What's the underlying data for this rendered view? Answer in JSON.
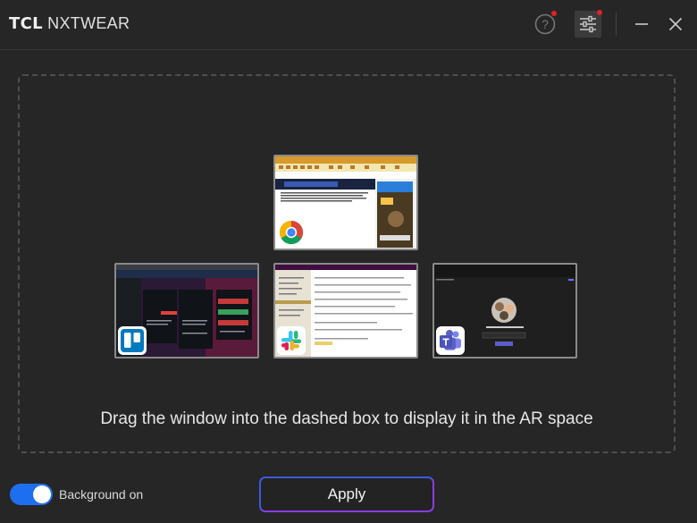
{
  "header": {
    "brand_bold": "TCL",
    "brand_light": "NXTWEAR"
  },
  "toolbar": {
    "help_icon": "help-circle-icon",
    "settings_icon": "sliders-icon",
    "minimize_icon": "minimize-icon",
    "close_icon": "close-icon",
    "notification_dot_color": "#e0202a"
  },
  "windows": [
    {
      "app": "chrome",
      "icon": "chrome-icon"
    },
    {
      "app": "trello",
      "icon": "trello-icon"
    },
    {
      "app": "slack",
      "icon": "slack-icon"
    },
    {
      "app": "teams",
      "icon": "teams-icon"
    }
  ],
  "dropzone": {
    "hint": "Drag the window into the dashed box to display it in the AR space"
  },
  "footer": {
    "background_toggle_on": true,
    "background_label": "Background on",
    "apply_label": "Apply"
  },
  "colors": {
    "accent": "#1e6ff0",
    "apply_border_start": "#3c5cd8",
    "apply_border_end": "#8a3ce0"
  }
}
